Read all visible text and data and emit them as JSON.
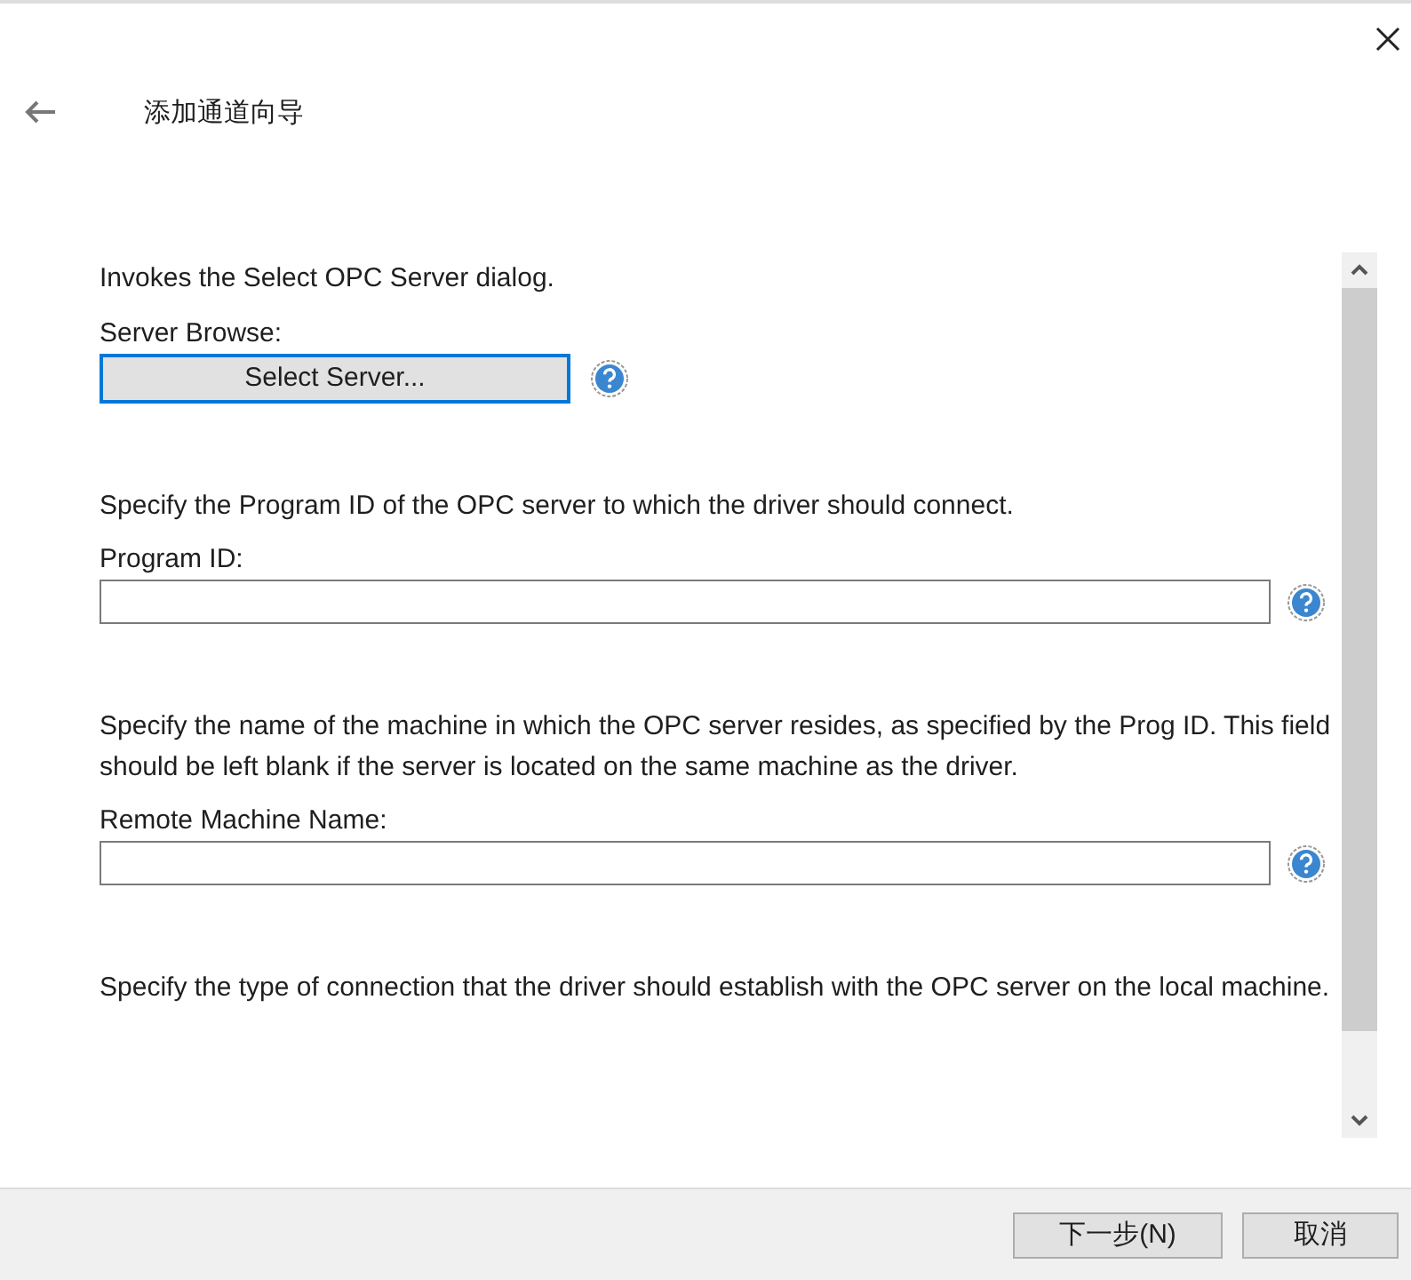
{
  "window": {
    "title": "添加通道向导"
  },
  "sections": [
    {
      "kind": "button",
      "description": "Invokes the Select OPC Server dialog.",
      "label": "Server Browse:",
      "button": {
        "label": "Select Server...",
        "focused": true
      }
    },
    {
      "kind": "field",
      "description": "Specify the Program ID of the OPC server to which the driver should connect.",
      "label": "Program ID:"
    },
    {
      "kind": "field",
      "description": "Specify the name of the machine in which the OPC server resides, as specified by the Prog ID. This field should be left blank if the server is located on the same machine as the driver.",
      "label": "Remote Machine Name:"
    },
    {
      "kind": "text",
      "description": "Specify the type of connection that the driver should establish with the OPC server on the local machine."
    }
  ],
  "buttons": [
    {
      "label": "下一步(N)",
      "kind": "primary"
    },
    {
      "label": "取消",
      "kind": "cancel"
    }
  ]
}
